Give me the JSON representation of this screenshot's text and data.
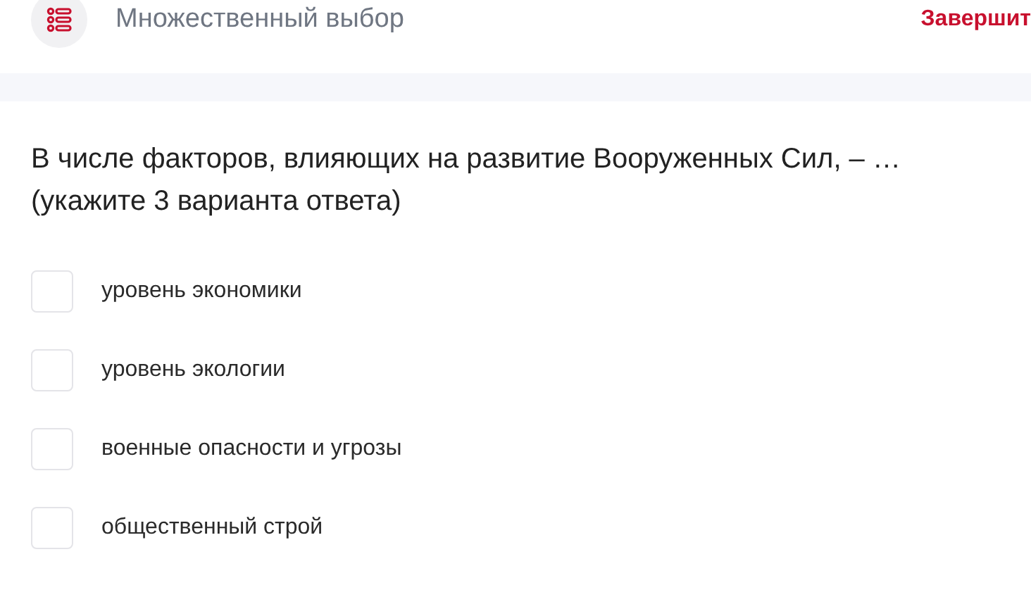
{
  "header": {
    "title": "Множественный выбор",
    "finish_button": "Завершит"
  },
  "question": {
    "text": "В числе факторов, влияющих на развитие Вооруженных Сил, – …\n(укажите 3 варианта ответа)"
  },
  "options": [
    {
      "label": "уровень экономики",
      "checked": false
    },
    {
      "label": "уровень экологии",
      "checked": false
    },
    {
      "label": "военные опасности и угрозы",
      "checked": false
    },
    {
      "label": "общественный строй",
      "checked": false
    }
  ]
}
